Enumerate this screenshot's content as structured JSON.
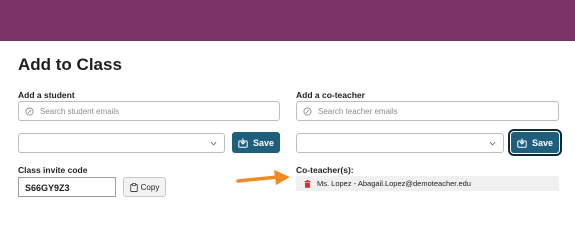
{
  "page": {
    "title": "Add to Class"
  },
  "colors": {
    "header_band": "#7b3468",
    "save_button": "#1f5f7e",
    "delete_icon": "#d32f2f",
    "annotation_arrow": "#f08a24"
  },
  "student": {
    "label": "Add a student",
    "search_placeholder": "Search student emails",
    "search_icon": "search-icon",
    "select_value": "",
    "save_label": "Save"
  },
  "coteacher": {
    "label": "Add a co-teacher",
    "search_placeholder": "Search teacher emails",
    "search_icon": "search-icon",
    "select_value": "",
    "save_label": "Save",
    "list_label": "Co-teacher(s):",
    "list": [
      {
        "text": "Ms. Lopez - Abagail.Lopez@demoteacher.edu",
        "icon": "trash-icon"
      }
    ]
  },
  "invite": {
    "label": "Class invite code",
    "code": "S66GY9Z3",
    "copy_label": "Copy",
    "copy_icon": "clipboard-icon"
  }
}
